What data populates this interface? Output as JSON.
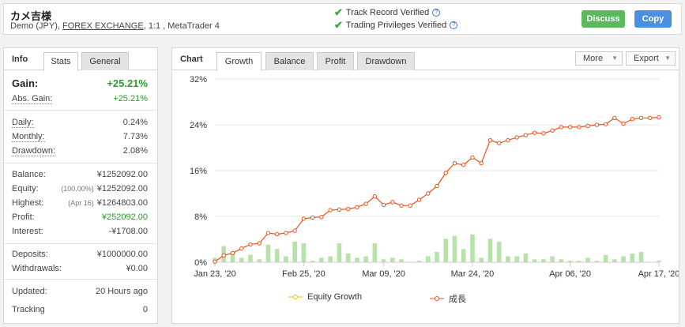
{
  "account": {
    "name": "カメ吉様",
    "type_text": "Demo (JPY), ",
    "broker": "FOREX EXCHANGE",
    "details": ", 1:1 , MetaTrader 4"
  },
  "verification": {
    "track_record": "Track Record Verified",
    "trading_privileges": "Trading Privileges Verified",
    "help_glyph": "?"
  },
  "actions": {
    "discuss": "Discuss",
    "copy": "Copy"
  },
  "left_tabs": {
    "title": "Info",
    "stats": "Stats",
    "general": "General"
  },
  "stats": {
    "gain_label": "Gain:",
    "gain_value": "+25.21%",
    "abs_gain_label": "Abs. Gain:",
    "abs_gain_value": "+25.21%",
    "daily_label": "Daily:",
    "daily_value": "0.24%",
    "monthly_label": "Monthly:",
    "monthly_value": "7.73%",
    "drawdown_label": "Drawdown:",
    "drawdown_value": "2.08%",
    "balance_label": "Balance:",
    "balance_value": "¥1252092.00",
    "equity_label": "Equity:",
    "equity_note": "(100.00%)",
    "equity_value": "¥1252092.00",
    "highest_label": "Highest:",
    "highest_note": "(Apr 16)",
    "highest_value": "¥1264803.00",
    "profit_label": "Profit:",
    "profit_value": "¥252092.00",
    "interest_label": "Interest:",
    "interest_value": "-¥1708.00",
    "deposits_label": "Deposits:",
    "deposits_value": "¥1000000.00",
    "withdrawals_label": "Withdrawals:",
    "withdrawals_value": "¥0.00",
    "updated_label": "Updated:",
    "updated_value": "20 Hours ago",
    "tracking_label": "Tracking",
    "tracking_value": "0"
  },
  "chart_tabs": {
    "title": "Chart",
    "growth": "Growth",
    "balance": "Balance",
    "profit": "Profit",
    "drawdown": "Drawdown",
    "more": "More",
    "export": "Export",
    "caret": "▼"
  },
  "colors": {
    "line": "#e8531f",
    "bars": "#b7e2a8",
    "equity": "#f0c000",
    "green": "#2a9c2a",
    "discuss": "#5cb85c",
    "copy": "#4a90e2"
  },
  "chart_data": {
    "type": "line",
    "ylim": [
      0,
      32
    ],
    "y_ticks": [
      "0%",
      "8%",
      "16%",
      "24%",
      "32%"
    ],
    "x_ticks": [
      "Jan 23, '20",
      "Feb 25, '20",
      "Mar 09, '20",
      "Mar 24, '20",
      "Apr 06, '20",
      "Apr 17, '20"
    ],
    "x_tick_index": [
      0,
      10,
      19,
      29,
      40,
      50
    ],
    "series": [
      {
        "name": "Equity Growth",
        "values": []
      },
      {
        "name": "成長",
        "values": [
          0.1,
          1.2,
          1.6,
          2.4,
          3.1,
          3.3,
          5.1,
          4.9,
          5.1,
          5.5,
          7.6,
          7.8,
          7.9,
          9.1,
          9.2,
          9.3,
          9.6,
          10.2,
          11.5,
          10.0,
          10.5,
          9.9,
          9.9,
          10.9,
          12.0,
          13.3,
          15.6,
          17.3,
          17.0,
          18.3,
          17.3,
          21.3,
          20.8,
          21.3,
          21.8,
          22.2,
          22.6,
          22.5,
          23.0,
          23.6,
          23.6,
          23.6,
          23.8,
          24.0,
          24.1,
          25.2,
          24.2,
          25.0,
          25.2,
          25.2,
          25.3
        ]
      }
    ],
    "bars": [
      0.3,
      1.1,
      0.7,
      0.3,
      0.5,
      0.2,
      1.2,
      0.9,
      0.4,
      1.4,
      1.3,
      0.1,
      0.3,
      0.4,
      1.3,
      0.6,
      0.3,
      0.4,
      1.3,
      0.2,
      0.3,
      0.2,
      0.0,
      0.1,
      0.4,
      0.7,
      1.6,
      1.8,
      0.9,
      1.9,
      0.3,
      1.6,
      1.4,
      0.4,
      0.4,
      0.6,
      0.2,
      0.2,
      0.4,
      0.2,
      0.1,
      0.1,
      0.3,
      0.1,
      0.5,
      0.2,
      0.4,
      0.6,
      0.7,
      0.0,
      0.1
    ],
    "bar_scale_max": 4.0,
    "grid": true,
    "legend": "bottom"
  }
}
